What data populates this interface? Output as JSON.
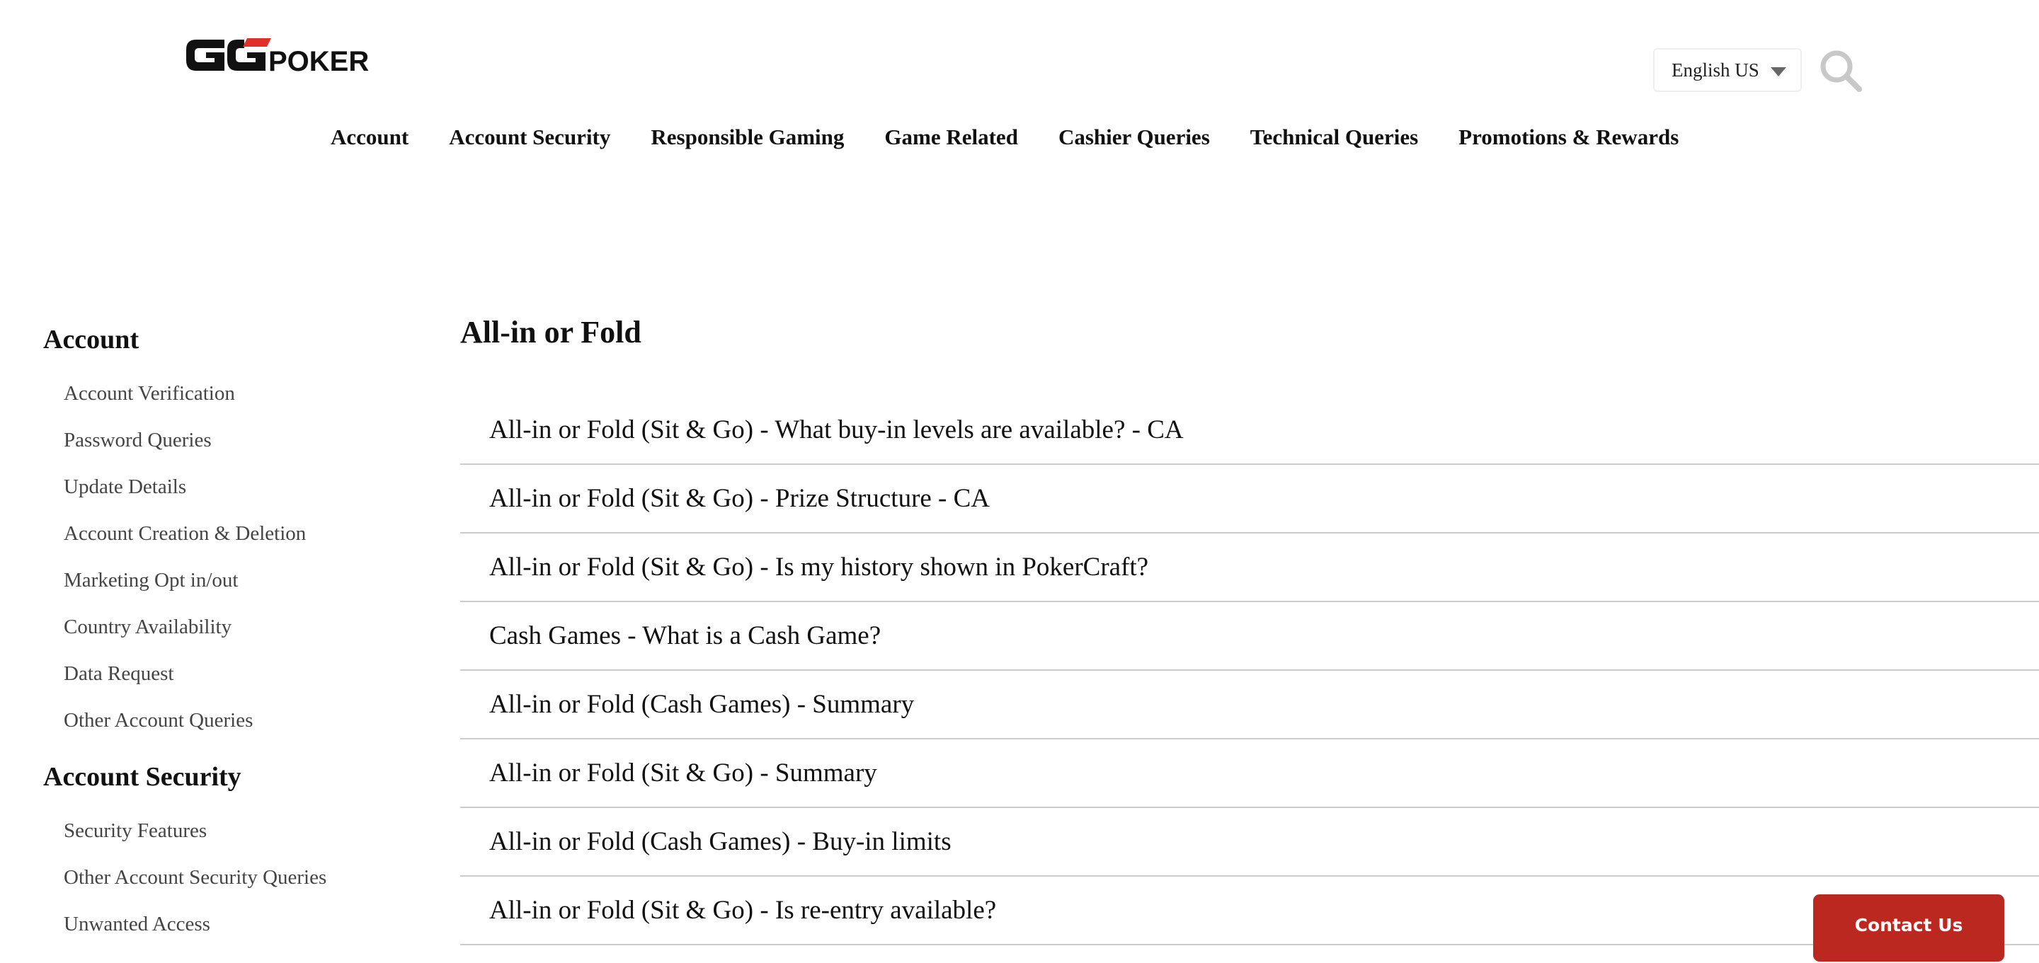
{
  "header": {
    "logo_text": "GGPOKER",
    "language": {
      "selected": "English US",
      "icon": "caret-down-icon"
    },
    "search_icon": "search-icon",
    "nav": [
      "Account",
      "Account Security",
      "Responsible Gaming",
      "Game Related",
      "Cashier Queries",
      "Technical Queries",
      "Promotions & Rewards"
    ]
  },
  "sidebar": {
    "sections": [
      {
        "title": "Account",
        "items": [
          "Account Verification",
          "Password Queries",
          "Update Details",
          "Account Creation & Deletion",
          "Marketing Opt in/out",
          "Country Availability",
          "Data Request",
          "Other Account Queries"
        ]
      },
      {
        "title": "Account Security",
        "items": [
          "Security Features",
          "Other Account Security Queries",
          "Unwanted Access"
        ]
      }
    ]
  },
  "main": {
    "title": "All-in or Fold",
    "articles": [
      "All-in or Fold (Sit & Go) - What buy-in levels are available? - CA",
      "All-in or Fold (Sit & Go) - Prize Structure - CA",
      "All-in or Fold (Sit & Go) - Is my history shown in PokerCraft?",
      "Cash Games - What is a Cash Game?",
      "All-in or Fold (Cash Games) - Summary",
      "All-in or Fold (Sit & Go) - Summary",
      "All-in or Fold (Cash Games) - Buy-in limits",
      "All-in or Fold (Sit & Go) - Is re-entry available?"
    ]
  },
  "contact_button": {
    "label": "Contact Us",
    "color": "#bb2820"
  },
  "colors": {
    "brand_red": "#e0302a",
    "text": "#111111",
    "muted": "#444444",
    "divider": "#cccccc"
  }
}
